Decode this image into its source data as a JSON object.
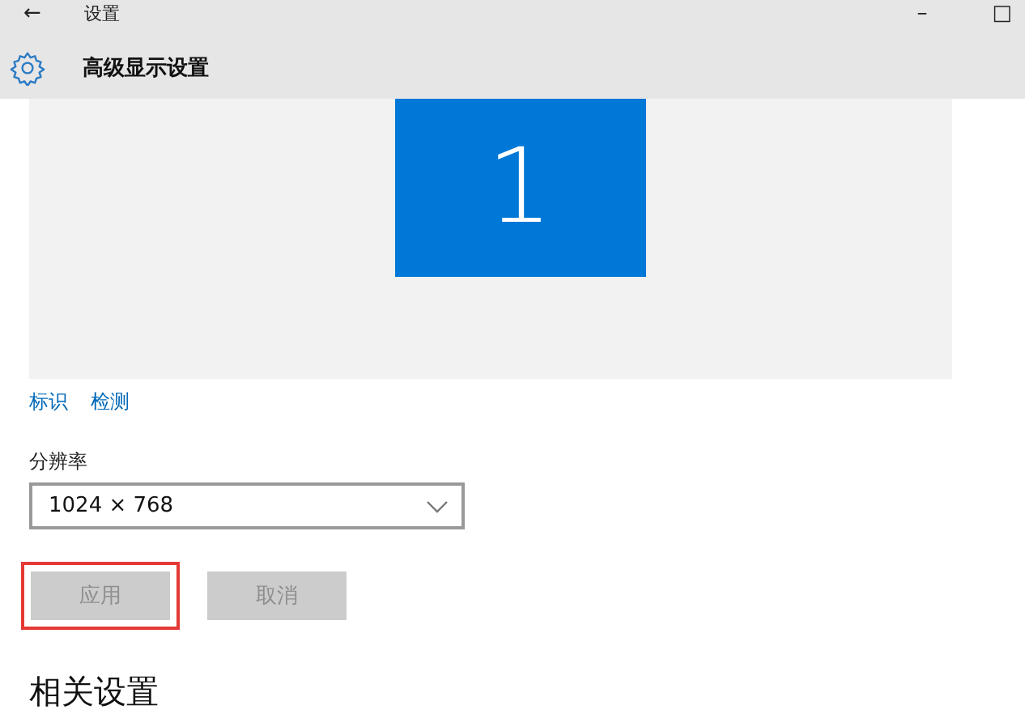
{
  "window": {
    "title": "设置",
    "back": "←",
    "minimize": "–",
    "maximize": "□"
  },
  "header": {
    "title": "高级显示设置"
  },
  "preview": {
    "monitors": [
      {
        "label": "1",
        "selected": true
      }
    ]
  },
  "links": [
    {
      "label": "标识"
    },
    {
      "label": "检测"
    }
  ],
  "resolution": {
    "label": "分辨率",
    "value": "1024 × 768"
  },
  "buttons": [
    {
      "label": "应用",
      "disabled": true,
      "highlighted": true
    },
    {
      "label": "取消",
      "disabled": true,
      "highlighted": false
    }
  ],
  "related": {
    "title": "相关设置"
  }
}
